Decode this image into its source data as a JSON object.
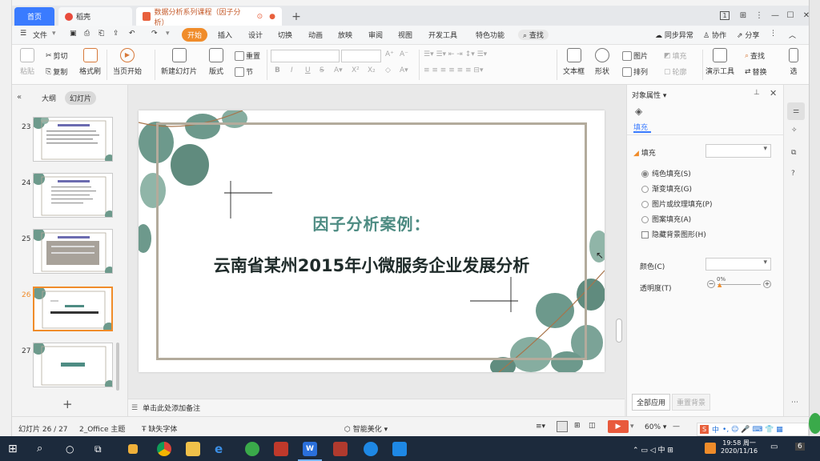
{
  "tabs": {
    "home": "首页",
    "docer": "稻壳",
    "document": "数据分析系列课程（因子分析）"
  },
  "window": {
    "badge": "1"
  },
  "menu": {
    "file": "文件",
    "items": [
      "开始",
      "插入",
      "设计",
      "切换",
      "动画",
      "放映",
      "审阅",
      "视图",
      "开发工具",
      "特色功能"
    ],
    "search": "查找",
    "sync": "同步异常",
    "collab": "协作",
    "share": "分享"
  },
  "ribbon": {
    "paste": "粘贴",
    "cut": "剪切",
    "copy": "复制",
    "format_painter": "格式刷",
    "from_current": "当页开始",
    "new_slide": "新建幻灯片",
    "layout": "版式",
    "section": "节",
    "reset": "重置",
    "font_bold": "B",
    "font_italic": "I",
    "font_underline": "U",
    "font_strike": "S",
    "textbox": "文本框",
    "shape": "形状",
    "arrange": "排列",
    "picture": "图片",
    "fill": "填充",
    "outline": "轮廓",
    "presentation_tools": "演示工具",
    "find": "查找",
    "replace": "替换",
    "select": "选"
  },
  "left_panel": {
    "tab_outline": "大纲",
    "tab_slides": "幻灯片",
    "thumbnails": [
      {
        "num": "23"
      },
      {
        "num": "24"
      },
      {
        "num": "25"
      },
      {
        "num": "26"
      },
      {
        "num": "27"
      }
    ],
    "add": "+"
  },
  "slide": {
    "title1": "因子分析案例：",
    "title2": "云南省某州2015年小微服务企业发展分析"
  },
  "notes": {
    "placeholder": "单击此处添加备注"
  },
  "props": {
    "title": "对象属性",
    "tab_fill": "填充",
    "section_fill": "填充",
    "options": [
      "纯色填充(S)",
      "渐变填充(G)",
      "图片或纹理填充(P)",
      "图案填充(A)"
    ],
    "hide_bg": "隐藏背景图形(H)",
    "color_label": "颜色(C)",
    "transparency_label": "透明度(T)",
    "transparency_value": "0%",
    "apply_all": "全部应用",
    "reset_bg": "重置背景"
  },
  "status": {
    "slide_info": "幻灯片 26 / 27",
    "theme": "2_Office 主题",
    "missing_font": "缺失字体",
    "beautify": "智能美化",
    "zoom": "60%"
  },
  "taskbar": {
    "time": "19:58 周一",
    "date": "2020/11/16",
    "ime": "中",
    "badge": "6"
  },
  "colors": {
    "accent_orange": "#f08c2a",
    "home_tab_blue": "#3a7bff",
    "title_teal": "#4e8c83"
  }
}
